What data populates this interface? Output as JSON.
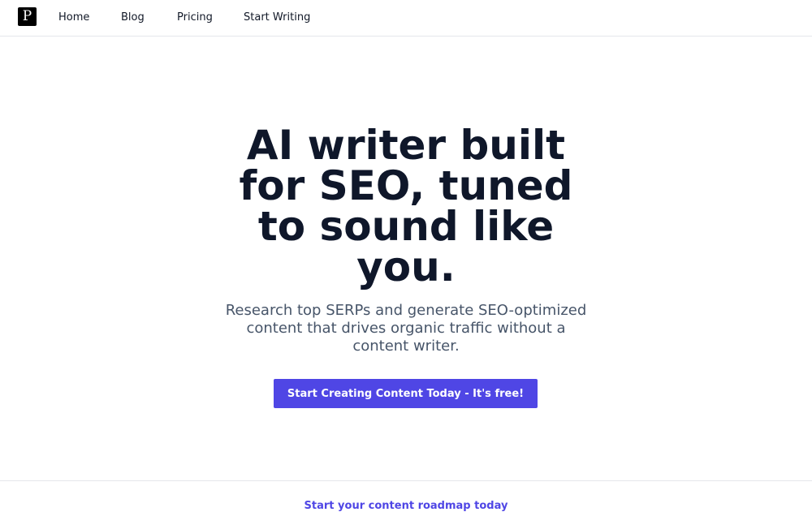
{
  "nav": {
    "logo_letter": "P",
    "items": [
      {
        "label": "Home"
      },
      {
        "label": "Blog"
      },
      {
        "label": "Pricing"
      },
      {
        "label": "Start Writing"
      }
    ]
  },
  "hero": {
    "title_lines": [
      "AI writer built",
      "for SEO, tuned",
      "to sound like",
      "you."
    ],
    "subtitle_lines": [
      "Research top SERPs and generate SEO-optimized",
      "content that drives organic traffic without a",
      "content writer."
    ],
    "cta_label": "Start Creating Content Today - It's free!"
  },
  "next_section": {
    "heading": "Start your content roadmap today"
  },
  "colors": {
    "accent": "#4f46e5",
    "title": "#0f172a",
    "subtitle": "#475569"
  }
}
